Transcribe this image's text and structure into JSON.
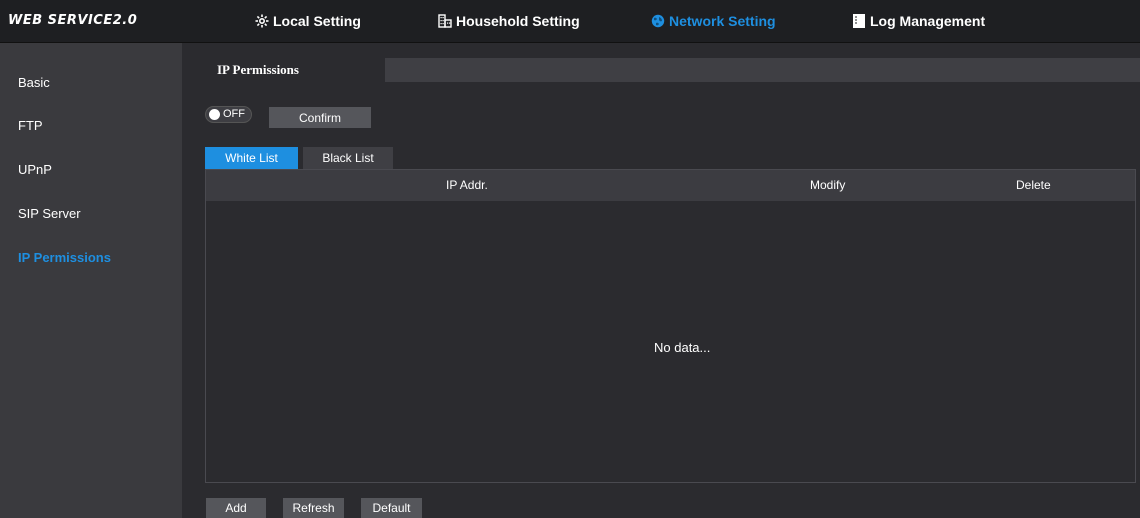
{
  "app": {
    "logo": "WEB SERVICE2.0"
  },
  "nav": [
    {
      "label": "Local Setting",
      "icon": "gear-icon"
    },
    {
      "label": "Household Setting",
      "icon": "building-icon"
    },
    {
      "label": "Network Setting",
      "icon": "globe-icon",
      "active": true
    },
    {
      "label": "Log Management",
      "icon": "log-icon"
    }
  ],
  "sidebar": {
    "items": [
      {
        "label": "Basic"
      },
      {
        "label": "FTP"
      },
      {
        "label": "UPnP"
      },
      {
        "label": "SIP Server"
      },
      {
        "label": "IP Permissions",
        "active": true
      }
    ]
  },
  "main": {
    "tab": "IP Permissions",
    "toggle": {
      "label": "OFF",
      "state": "off"
    },
    "confirm_label": "Confirm",
    "sub_tabs": [
      {
        "label": "White List",
        "active": true
      },
      {
        "label": "Black List",
        "active": false
      }
    ],
    "table": {
      "columns": [
        "IP Addr.",
        "Modify",
        "Delete"
      ],
      "empty_text": "No data..."
    },
    "buttons": {
      "add": "Add",
      "refresh": "Refresh",
      "default": "Default"
    }
  },
  "colors": {
    "accent": "#1e8fe0",
    "background": "#2b2b2f",
    "sidebar": "#3a3a3e",
    "topbar": "#1e1f22"
  }
}
